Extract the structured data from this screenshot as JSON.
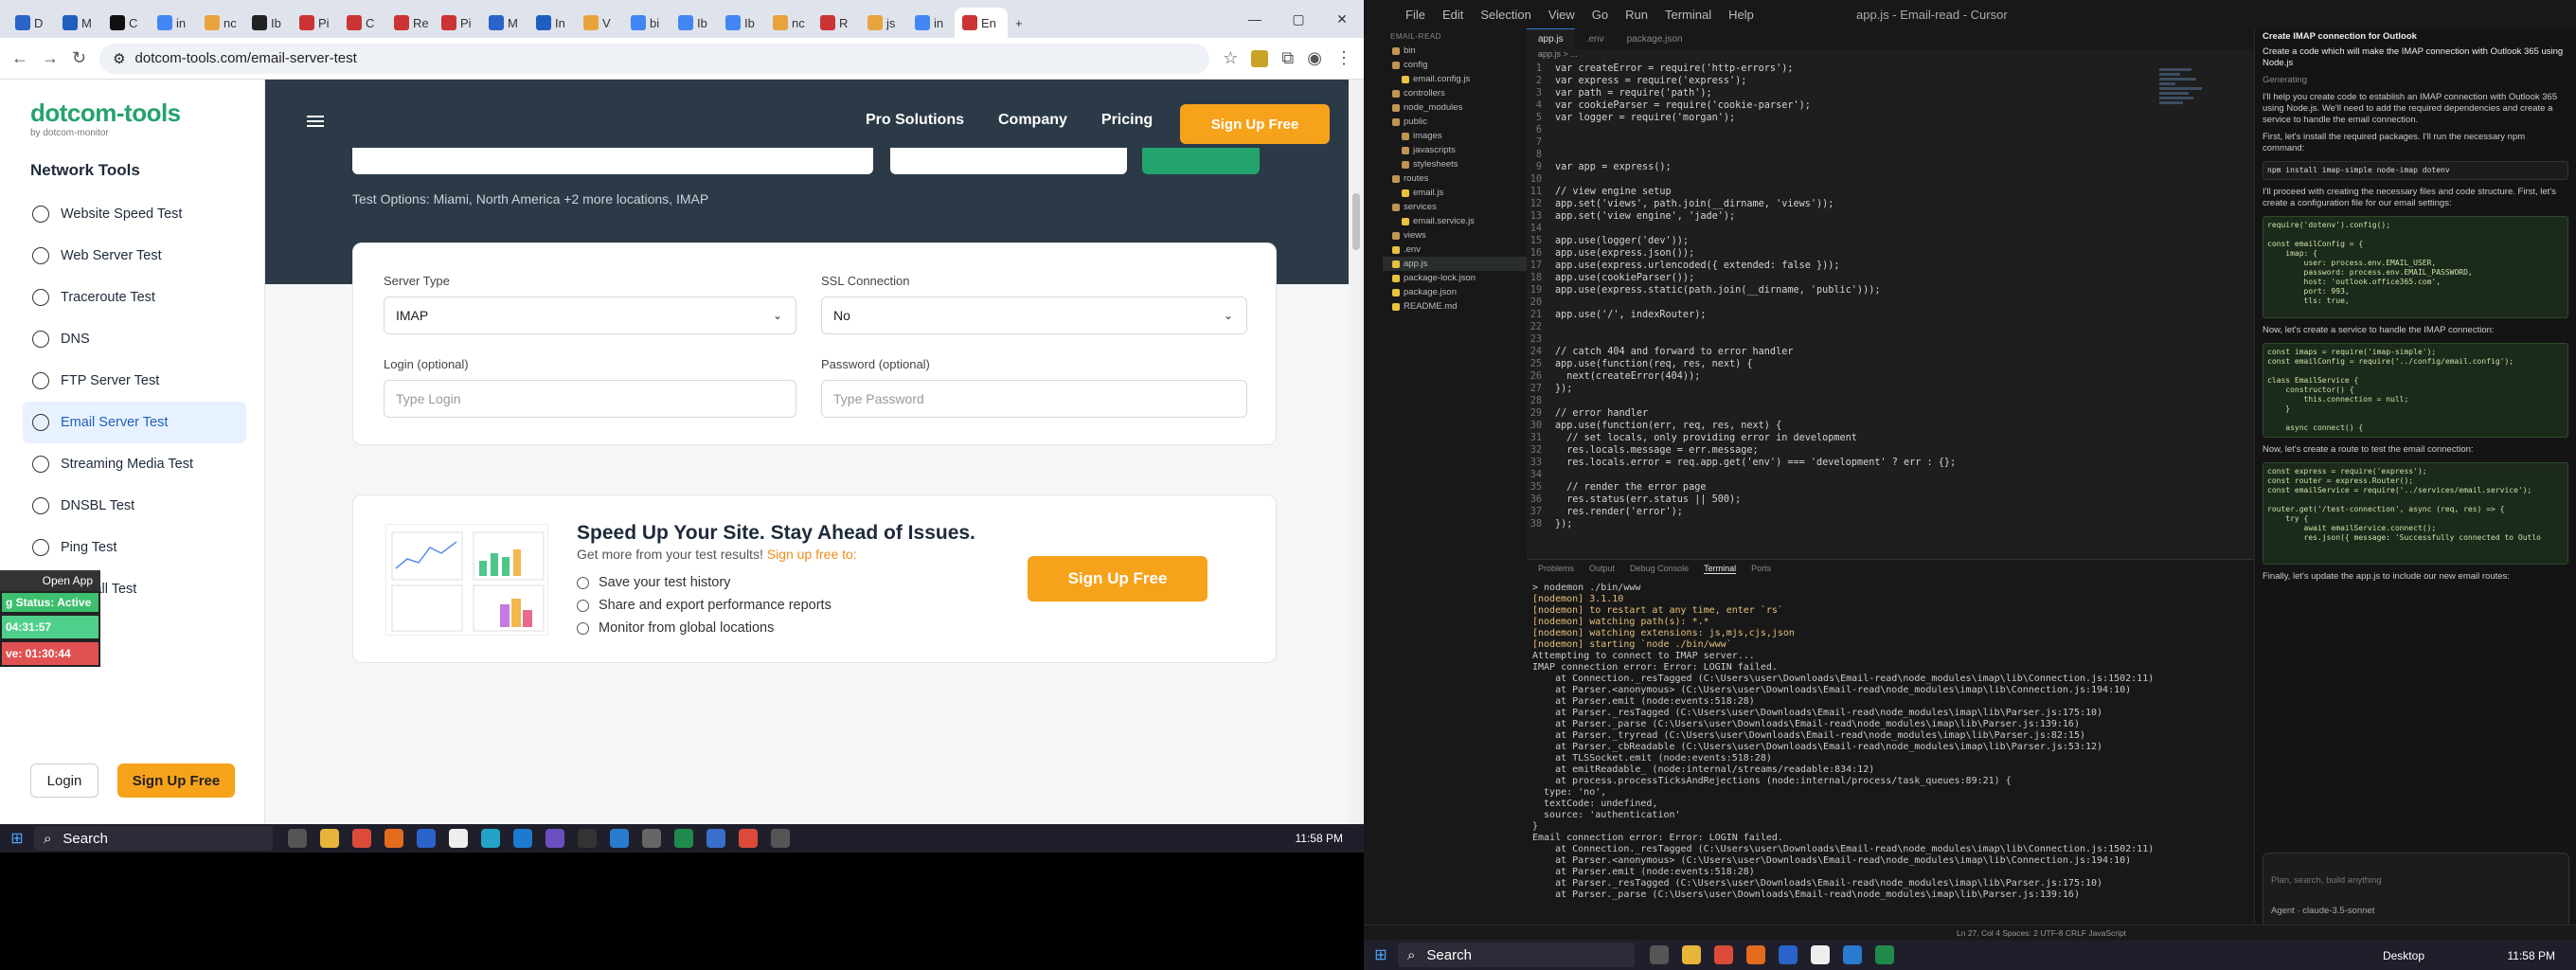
{
  "browser": {
    "tabs": [
      "D",
      "M",
      "C",
      "in",
      "nc",
      "Ib",
      "Pi",
      "C",
      "Re",
      "Pi",
      "M",
      "In",
      "V",
      "bi",
      "Ib",
      "Ib",
      "nc",
      "R",
      "js",
      "in",
      "En"
    ],
    "url": "dotcom-tools.com/email-server-test"
  },
  "site": {
    "logo": "dotcom-tools",
    "logo_sub": "by dotcom-monitor",
    "sidebar_title": "Network Tools",
    "menu": [
      {
        "label": "Website Speed Test"
      },
      {
        "label": "Web Server Test"
      },
      {
        "label": "Traceroute Test"
      },
      {
        "label": "DNS"
      },
      {
        "label": "FTP Server Test"
      },
      {
        "label": "Email Server Test"
      },
      {
        "label": "Streaming Media Test"
      },
      {
        "label": "DNSBL Test"
      },
      {
        "label": "Ping Test"
      },
      {
        "label": "Firewall Test"
      }
    ],
    "login": "Login",
    "signup": "Sign Up Free",
    "nav": {
      "links": [
        "Pro Solutions",
        "Company",
        "Pricing"
      ],
      "signup": "Sign Up Free"
    },
    "test_options": "Test Options: Miami, North America +2 more locations, IMAP",
    "form": {
      "server_type_label": "Server Type",
      "server_type_value": "IMAP",
      "ssl_label": "SSL Connection",
      "ssl_value": "No",
      "login_label": "Login (optional)",
      "login_placeholder": "Type Login",
      "password_label": "Password (optional)",
      "password_placeholder": "Type Password"
    },
    "promo": {
      "title": "Speed Up Your Site. Stay Ahead of Issues.",
      "subtitle": "Get more from your test results!",
      "subtitle_link": "Sign up free to:",
      "items": [
        "Save your test history",
        "Share and export performance reports",
        "Monitor from global locations"
      ],
      "button": "Sign Up Free"
    }
  },
  "overlay": {
    "open_app": "Open App",
    "status": "g Status: Active",
    "time1": "04:31:57",
    "time2": "ve: 01:30:44"
  },
  "taskbar": {
    "search": "Search",
    "time": "11:58 PM"
  },
  "cursor": {
    "menus": [
      "File",
      "Edit",
      "Selection",
      "View",
      "Go",
      "Run",
      "Terminal",
      "Help"
    ],
    "title": "app.js - Email-read - Cursor",
    "explorer_header": "EMAIL-READ",
    "files": [
      {
        "name": "bin",
        "type": "folder"
      },
      {
        "name": "config",
        "type": "folder"
      },
      {
        "name": "email.config.js",
        "type": "file"
      },
      {
        "name": "controllers",
        "type": "folder"
      },
      {
        "name": "node_modules",
        "type": "folder"
      },
      {
        "name": "public",
        "type": "folder"
      },
      {
        "name": "images",
        "type": "folder"
      },
      {
        "name": "javascripts",
        "type": "folder"
      },
      {
        "name": "stylesheets",
        "type": "folder"
      },
      {
        "name": "routes",
        "type": "folder"
      },
      {
        "name": "email.js",
        "type": "file"
      },
      {
        "name": "services",
        "type": "folder"
      },
      {
        "name": "email.service.js",
        "type": "file"
      },
      {
        "name": "views",
        "type": "folder"
      },
      {
        "name": ".env",
        "type": "file"
      },
      {
        "name": "app.js",
        "type": "file"
      },
      {
        "name": "package-lock.json",
        "type": "file"
      },
      {
        "name": "package.json",
        "type": "file"
      },
      {
        "name": "README.md",
        "type": "file"
      }
    ],
    "tabs": [
      "app.js",
      ".env",
      "package.json"
    ],
    "breadcrumb": "app.js > ...",
    "code": [
      "var createError = require('http-errors');",
      "var express = require('express');",
      "var path = require('path');",
      "var cookieParser = require('cookie-parser');",
      "var logger = require('morgan');",
      "",
      "",
      "",
      "var app = express();",
      "",
      "// view engine setup",
      "app.set('views', path.join(__dirname, 'views'));",
      "app.set('view engine', 'jade');",
      "",
      "app.use(logger('dev'));",
      "app.use(express.json());",
      "app.use(express.urlencoded({ extended: false }));",
      "app.use(cookieParser());",
      "app.use(express.static(path.join(__dirname, 'public')));",
      "",
      "app.use('/', indexRouter);",
      "",
      "",
      "// catch 404 and forward to error handler",
      "app.use(function(req, res, next) {",
      "  next(createError(404));",
      "});",
      "",
      "// error handler",
      "app.use(function(err, req, res, next) {",
      "  // set locals, only providing error in development",
      "  res.locals.message = err.message;",
      "  res.locals.error = req.app.get('env') === 'development' ? err : {};",
      "",
      "  // render the error page",
      "  res.status(err.status || 500);",
      "  res.render('error');",
      "});"
    ],
    "panel_tabs": [
      "Problems",
      "Output",
      "Debug Console",
      "Terminal",
      "Ports"
    ],
    "terminal": [
      "> nodemon ./bin/www",
      "",
      "[nodemon] 3.1.10",
      "[nodemon] to restart at any time, enter `rs`",
      "[nodemon] watching path(s): *.*",
      "[nodemon] watching extensions: js,mjs,cjs,json",
      "[nodemon] starting `node ./bin/www`",
      "Attempting to connect to IMAP server...",
      "IMAP connection error: Error: LOGIN failed.",
      "    at Connection._resTagged (C:\\Users\\user\\Downloads\\Email-read\\node_modules\\imap\\lib\\Connection.js:1502:11)",
      "    at Parser.<anonymous> (C:\\Users\\user\\Downloads\\Email-read\\node_modules\\imap\\lib\\Connection.js:194:10)",
      "    at Parser.emit (node:events:518:28)",
      "    at Parser._resTagged (C:\\Users\\user\\Downloads\\Email-read\\node_modules\\imap\\lib\\Parser.js:175:10)",
      "    at Parser._parse (C:\\Users\\user\\Downloads\\Email-read\\node_modules\\imap\\lib\\Parser.js:139:16)",
      "    at Parser._tryread (C:\\Users\\user\\Downloads\\Email-read\\node_modules\\imap\\lib\\Parser.js:82:15)",
      "    at Parser._cbReadable (C:\\Users\\user\\Downloads\\Email-read\\node_modules\\imap\\lib\\Parser.js:53:12)",
      "    at TLSSocket.emit (node:events:518:28)",
      "    at emitReadable_ (node:internal/streams/readable:834:12)",
      "    at process.processTicksAndRejections (node:internal/process/task_queues:89:21) {",
      "  type: 'no',",
      "  textCode: undefined,",
      "  source: 'authentication'",
      "}",
      "Email connection error: Error: LOGIN failed.",
      "    at Connection._resTagged (C:\\Users\\user\\Downloads\\Email-read\\node_modules\\imap\\lib\\Connection.js:1502:11)",
      "    at Parser.<anonymous> (C:\\Users\\user\\Downloads\\Email-read\\node_modules\\imap\\lib\\Connection.js:194:10)",
      "    at Parser.emit (node:events:518:28)",
      "    at Parser._resTagged (C:\\Users\\user\\Downloads\\Email-read\\node_modules\\imap\\lib\\Parser.js:175:10)",
      "    at Parser._parse (C:\\Users\\user\\Downloads\\Email-read\\node_modules\\imap\\lib\\Parser.js:139:16)"
    ],
    "chat": {
      "title": "Create IMAP connection for Outlook",
      "prompt": "Create a code which will make the IMAP connection with Outlook 365 using Node.js",
      "status": "Generating",
      "p1": "I'll help you create code to establish an IMAP connection with Outlook 365 using Node.js. We'll need to add the required dependencies and create a service to handle the email connection.",
      "p2": "First, let's install the required packages. I'll run the necessary npm command:",
      "cmd": "npm install imap-simple node-imap dotenv",
      "p3": "I'll proceed with creating the necessary files and code structure. First, let's create a configuration file for our email settings:",
      "code1": "require('dotenv').config();\n\nconst emailConfig = {\n    imap: {\n        user: process.env.EMAIL_USER,\n        password: process.env.EMAIL_PASSWORD,\n        host: 'outlook.office365.com',\n        port: 993,\n        tls: true,",
      "p4": "Now, let's create a service to handle the IMAP connection:",
      "code2": "const imaps = require('imap-simple');\nconst emailConfig = require('../config/email.config');\n\nclass EmailService {\n    constructor() {\n        this.connection = null;\n    }\n\n    async connect() {",
      "p5": "Now, let's create a route to test the email connection:",
      "code3": "const express = require('express');\nconst router = express.Router();\nconst emailService = require('../services/email.service');\n\nrouter.get('/test-connection', async (req, res) => {\n    try {\n        await emailService.connect();\n        res.json({ message: 'Successfully connected to Outlo",
      "p6": "Finally, let's update the app.js to include our new email routes:",
      "input_placeholder": "Plan, search, build anything",
      "model": "claude-3.5-sonnet",
      "agent": "Agent"
    },
    "status": "Ln 27, Col 4   Spaces: 2   UTF-8   CRLF   JavaScript"
  },
  "rtaskbar": {
    "search": "Search",
    "time": "11:58 PM",
    "desktop": "Desktop"
  }
}
